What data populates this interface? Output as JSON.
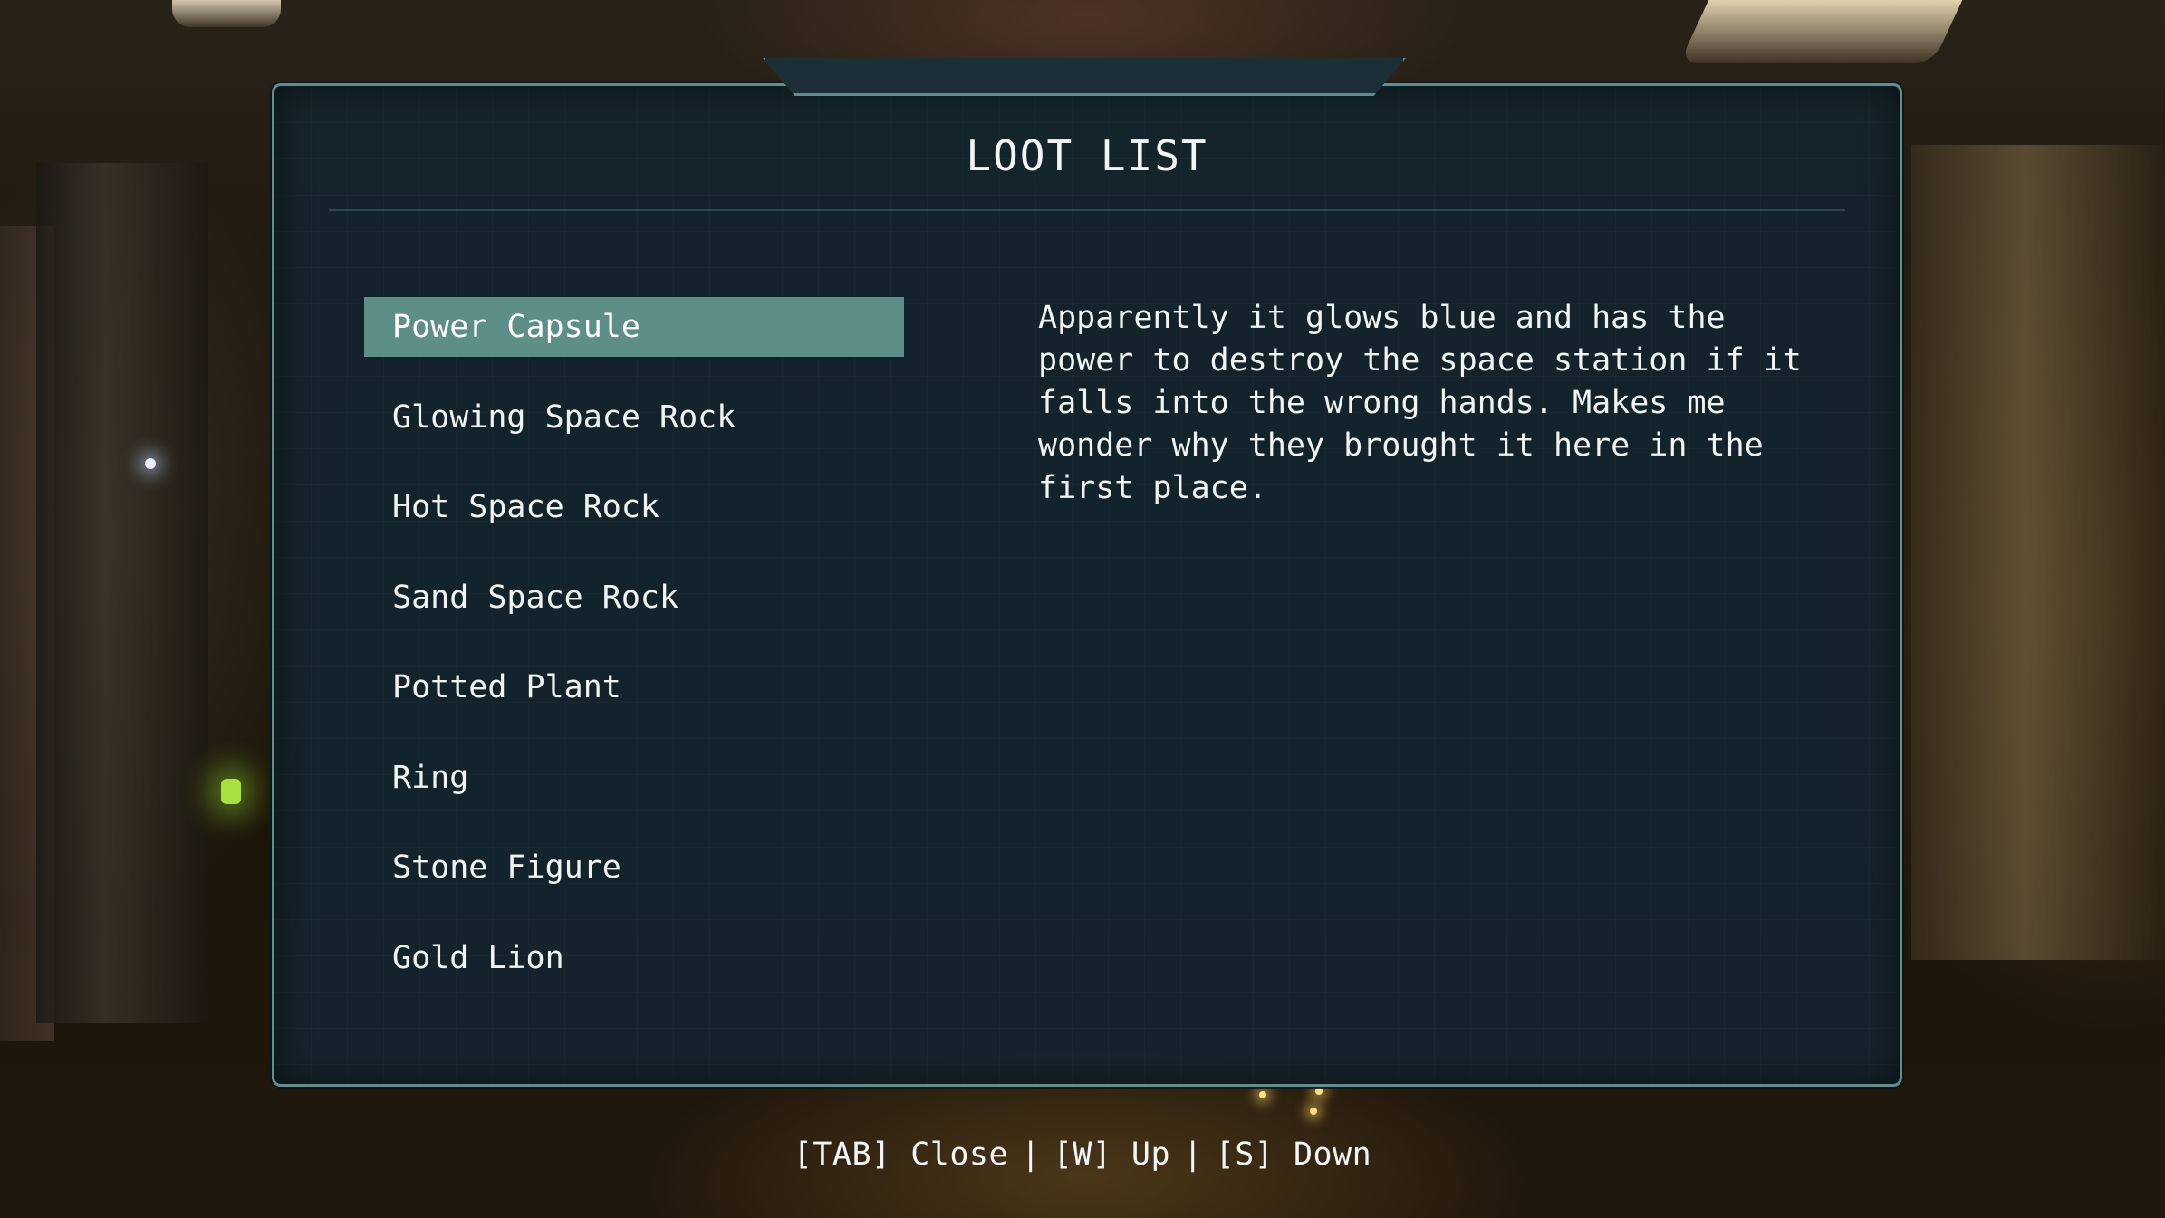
{
  "window": {
    "title": "LOOT LIST"
  },
  "loot": {
    "items": [
      {
        "label": "Power Capsule",
        "selected": true
      },
      {
        "label": "Glowing Space Rock",
        "selected": false
      },
      {
        "label": "Hot Space Rock",
        "selected": false
      },
      {
        "label": "Sand Space Rock",
        "selected": false
      },
      {
        "label": "Potted Plant",
        "selected": false
      },
      {
        "label": "Ring",
        "selected": false
      },
      {
        "label": "Stone Figure",
        "selected": false
      },
      {
        "label": "Gold Lion",
        "selected": false
      }
    ],
    "selected_description": "Apparently it glows blue and has the power to destroy the space station if it falls into the wrong hands. Makes me wonder why they brought it here in the first place."
  },
  "controls": {
    "close": "[TAB] Close",
    "separator": "|",
    "up": "[W] Up",
    "down": "[S] Down"
  },
  "colors": {
    "panel_border": "#5f8f8c",
    "panel_background": "#14242c",
    "selected_item": "#5e8e88",
    "text": "#f0f3f3"
  }
}
